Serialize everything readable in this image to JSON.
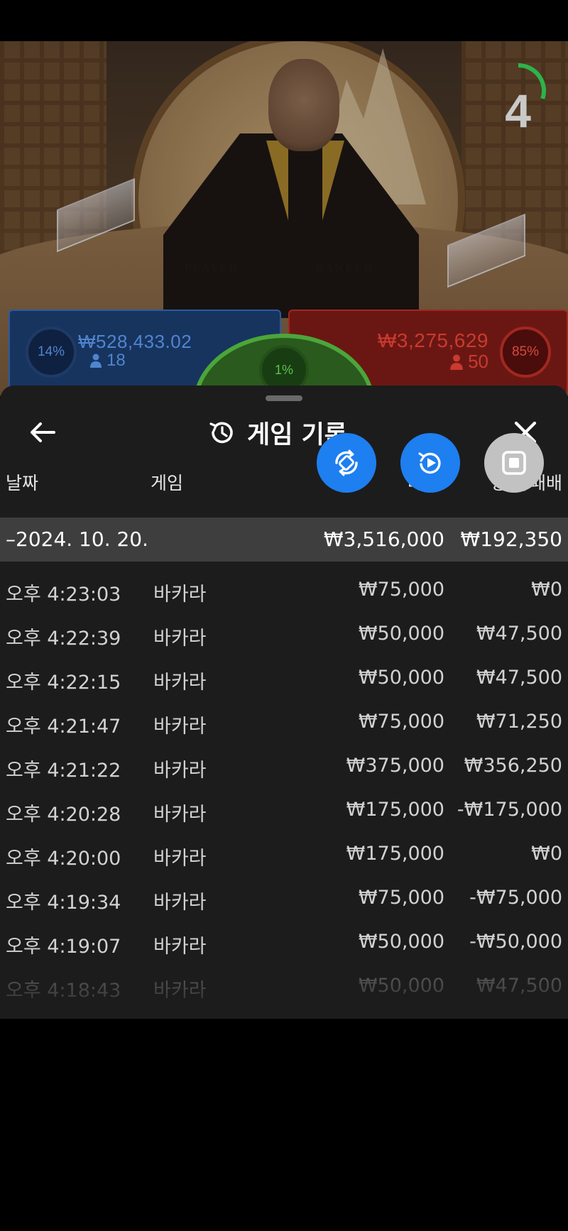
{
  "video": {
    "table_player_word": "PLAYER",
    "table_banker_word": "BANKER",
    "countdown": "4",
    "countdown_progress": 0.3
  },
  "bets": {
    "player": {
      "percent": "14%",
      "amount": "₩528,433.02",
      "count": "18",
      "color": "#4f85cf"
    },
    "banker": {
      "percent": "85%",
      "amount": "₩3,275,629",
      "count": "50",
      "color": "#c93a30"
    },
    "tie": {
      "percent": "1%",
      "color": "#5cc14a"
    }
  },
  "history": {
    "title": "게임 기록",
    "columns": {
      "date": "날짜",
      "game": "게임",
      "bet": "베팅",
      "win": "승리/패배"
    },
    "day": {
      "date": "–2024. 10. 20.",
      "bet": "₩3,516,000",
      "win": "₩192,350"
    },
    "rows": [
      {
        "time": "오후 4:23:03",
        "game": "바카라",
        "bet": "₩75,000",
        "win": "₩0"
      },
      {
        "time": "오후 4:22:39",
        "game": "바카라",
        "bet": "₩50,000",
        "win": "₩47,500"
      },
      {
        "time": "오후 4:22:15",
        "game": "바카라",
        "bet": "₩50,000",
        "win": "₩47,500"
      },
      {
        "time": "오후 4:21:47",
        "game": "바카라",
        "bet": "₩75,000",
        "win": "₩71,250"
      },
      {
        "time": "오후 4:21:22",
        "game": "바카라",
        "bet": "₩375,000",
        "win": "₩356,250"
      },
      {
        "time": "오후 4:20:28",
        "game": "바카라",
        "bet": "₩175,000",
        "win": "-₩175,000"
      },
      {
        "time": "오후 4:20:00",
        "game": "바카라",
        "bet": "₩175,000",
        "win": "₩0"
      },
      {
        "time": "오후 4:19:34",
        "game": "바카라",
        "bet": "₩75,000",
        "win": "-₩75,000"
      },
      {
        "time": "오후 4:19:07",
        "game": "바카라",
        "bet": "₩50,000",
        "win": "-₩50,000"
      },
      {
        "time": "오후 4:18:43",
        "game": "바카라",
        "bet": "₩50,000",
        "win": "₩47,500"
      }
    ]
  },
  "floating_buttons": [
    {
      "name": "rotate-screen-button",
      "icon": "rotate-icon",
      "color": "#1e7ff0"
    },
    {
      "name": "replay-button",
      "icon": "replay-icon",
      "color": "#1e7ff0"
    },
    {
      "name": "stop-recording-button",
      "icon": "stop-icon",
      "color": "#c2c2c2"
    }
  ]
}
